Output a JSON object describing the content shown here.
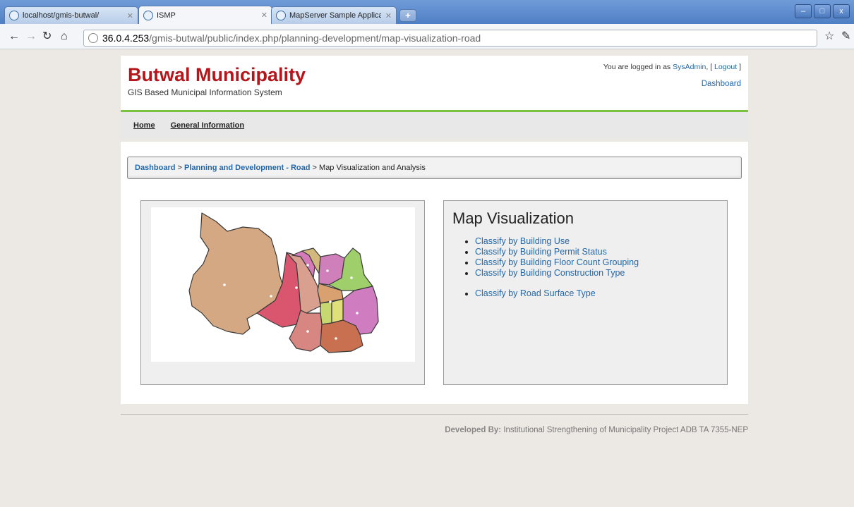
{
  "browser": {
    "tabs": [
      {
        "label": "localhost/gmis-butwal/",
        "active": false
      },
      {
        "label": "ISMP",
        "active": true
      },
      {
        "label": "MapServer Sample Application",
        "active": false
      }
    ],
    "new_tab": "+",
    "address": {
      "host": "36.0.4.253",
      "path": "/gmis-butwal/public/index.php/planning-development/map-visualization-road"
    },
    "window_buttons": [
      "–",
      "□",
      "x"
    ]
  },
  "header": {
    "title": "Butwal Municipality",
    "subtitle": "GIS Based Municipal Information System",
    "login_prefix": "You are logged in as ",
    "user": "SysAdmin",
    "login_sep": ", [ ",
    "logout": "Logout",
    "login_suffix": " ]",
    "dashboard": "Dashboard"
  },
  "nav": {
    "items": [
      {
        "label": "Home"
      },
      {
        "label": "General Information"
      }
    ]
  },
  "breadcrumb": {
    "items": [
      "Dashboard",
      "Planning and Development - Road"
    ],
    "separator": " > ",
    "current": "Map Visualization and Analysis"
  },
  "visualization": {
    "title": "Map Visualization",
    "building_links": [
      "Classify by Building Use",
      "Classify by Building Permit Status",
      "Classify by Building Floor Count Grouping",
      "Classify by Building Construction Type"
    ],
    "road_links": [
      "Classify by Road Surface Type"
    ]
  },
  "footer": {
    "label": "Developed By:",
    "text": " Institutional Strengthening of Municipality Project ADB TA 7355-NEP"
  },
  "colors": {
    "brand_red": "#b5161b",
    "link_blue": "#2367a8",
    "accent_green": "#7cc242"
  }
}
